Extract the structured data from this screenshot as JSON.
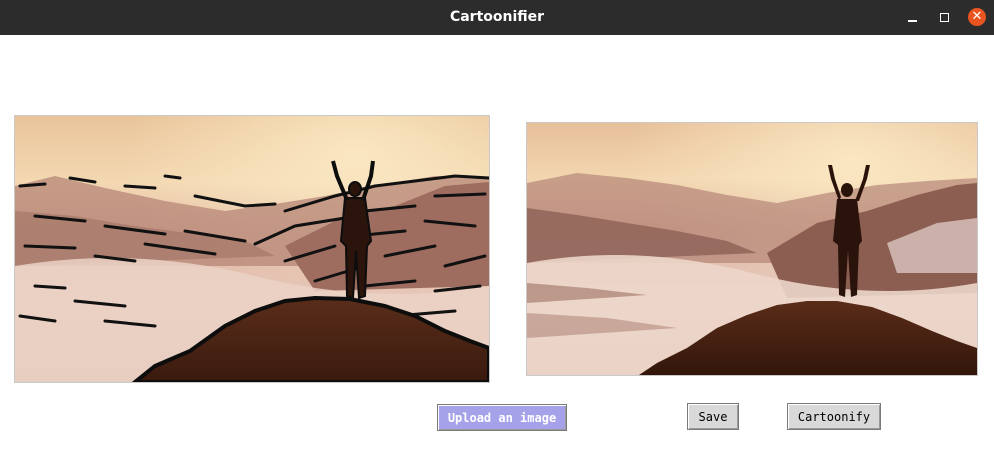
{
  "window": {
    "title": "Cartoonifier",
    "controls": [
      "minimize-icon",
      "maximize-icon",
      "close-icon"
    ],
    "close_glyph": "✕"
  },
  "images": {
    "cartoon": "cartoonified mountain sunrise image",
    "original": "original mountain sunrise image"
  },
  "buttons": {
    "upload_label": "Upload an image",
    "save_label": "Save",
    "cartoonify_label": "Cartoonify"
  },
  "colors": {
    "titlebar": "#2c2c2c",
    "close_button": "#e95420",
    "upload_button": "#a6a2ea",
    "button_gray": "#d9d9d9"
  }
}
